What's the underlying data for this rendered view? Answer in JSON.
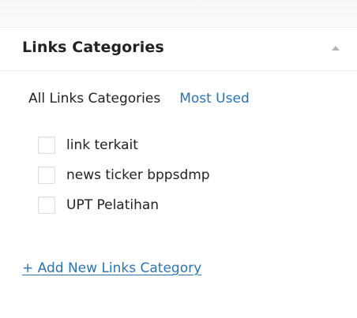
{
  "panel": {
    "title": "Links Categories",
    "toggle_icon": "triangle-up-icon"
  },
  "tabs": {
    "all_label": "All Links Categories",
    "used_label": "Most Used"
  },
  "checklist": {
    "items": [
      {
        "label": "link terkait",
        "checked": false
      },
      {
        "label": "news ticker bppsdmp",
        "checked": false
      },
      {
        "label": "UPT Pelatihan",
        "checked": false
      }
    ]
  },
  "add_link": {
    "label": "+ Add New Links Category"
  },
  "colors": {
    "link": "#2a73b3",
    "text": "#222222",
    "checkbox_border": "#dddddd"
  }
}
